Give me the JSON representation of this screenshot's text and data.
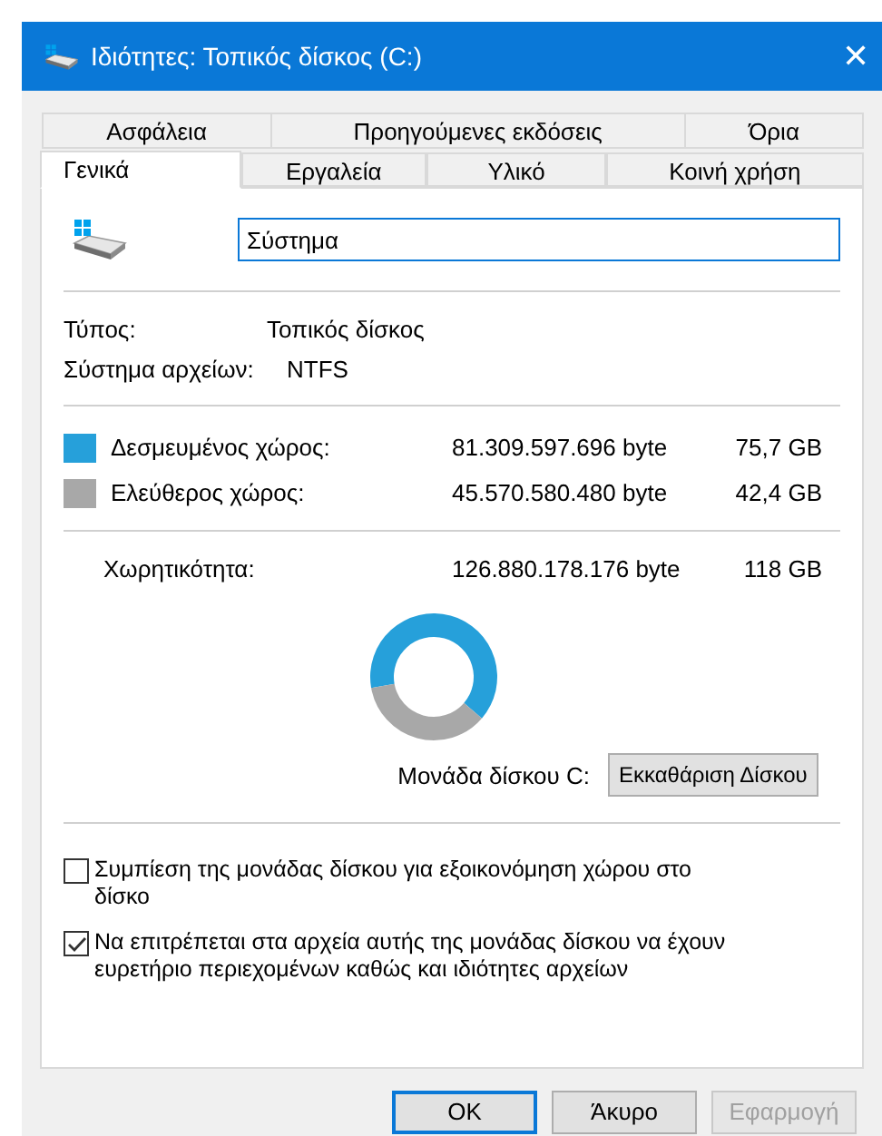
{
  "window": {
    "title": "Ιδιότητες: Τοπικός δίσκος (C:)",
    "close": "✕"
  },
  "tabs_back": [
    {
      "label": "Ασφάλεια",
      "selected": false
    },
    {
      "label": "Προηγούμενες εκδόσεις",
      "selected": false
    },
    {
      "label": "Όρια",
      "selected": false
    }
  ],
  "tabs_front": [
    {
      "label": "Γενικά",
      "selected": true
    },
    {
      "label": "Εργαλεία",
      "selected": false
    },
    {
      "label": "Υλικό",
      "selected": false
    },
    {
      "label": "Κοινή χρήση",
      "selected": false
    }
  ],
  "name_field": {
    "value": "Σύστημα"
  },
  "info": [
    {
      "label": "Τύπος:",
      "value": "Τοπικός δίσκος"
    },
    {
      "label": "Σύστημα αρχείων:",
      "value": "NTFS"
    }
  ],
  "space": [
    {
      "label": "Δεσμευμένος χώρος:",
      "bytes": "81.309.597.696 byte",
      "size": "75,7 GB",
      "color": "#26a0da"
    },
    {
      "label": "Ελεύθερος χώρος:",
      "bytes": "45.570.580.480 byte",
      "size": "42,4 GB",
      "color": "#a8a8a8"
    }
  ],
  "capacity": {
    "label": "Χωρητικότητα:",
    "bytes": "126.880.178.176 byte",
    "size": "118 GB"
  },
  "chart_data": {
    "type": "donut",
    "values": [
      64.1,
      35.9
    ]
  },
  "drive_label": "Μονάδα δίσκου C:",
  "cleanup_button": "Εκκαθάριση Δίσκου",
  "options": [
    {
      "label": "Συμπίεση της μονάδας δίσκου για εξοικονόμηση χώρου στο δίσκο",
      "checked": false
    },
    {
      "label": "Να επιτρέπεται στα αρχεία αυτής της μονάδας δίσκου να έχουν ευρετήριο περιεχομένων καθώς και ιδιότητες αρχείων",
      "checked": true
    }
  ],
  "buttons": [
    {
      "label": "OK",
      "kind": "default",
      "disabled": false
    },
    {
      "label": "Άκυρο",
      "kind": "normal",
      "disabled": false
    },
    {
      "label": "Εφαρμογή",
      "kind": "normal",
      "disabled": true
    }
  ]
}
